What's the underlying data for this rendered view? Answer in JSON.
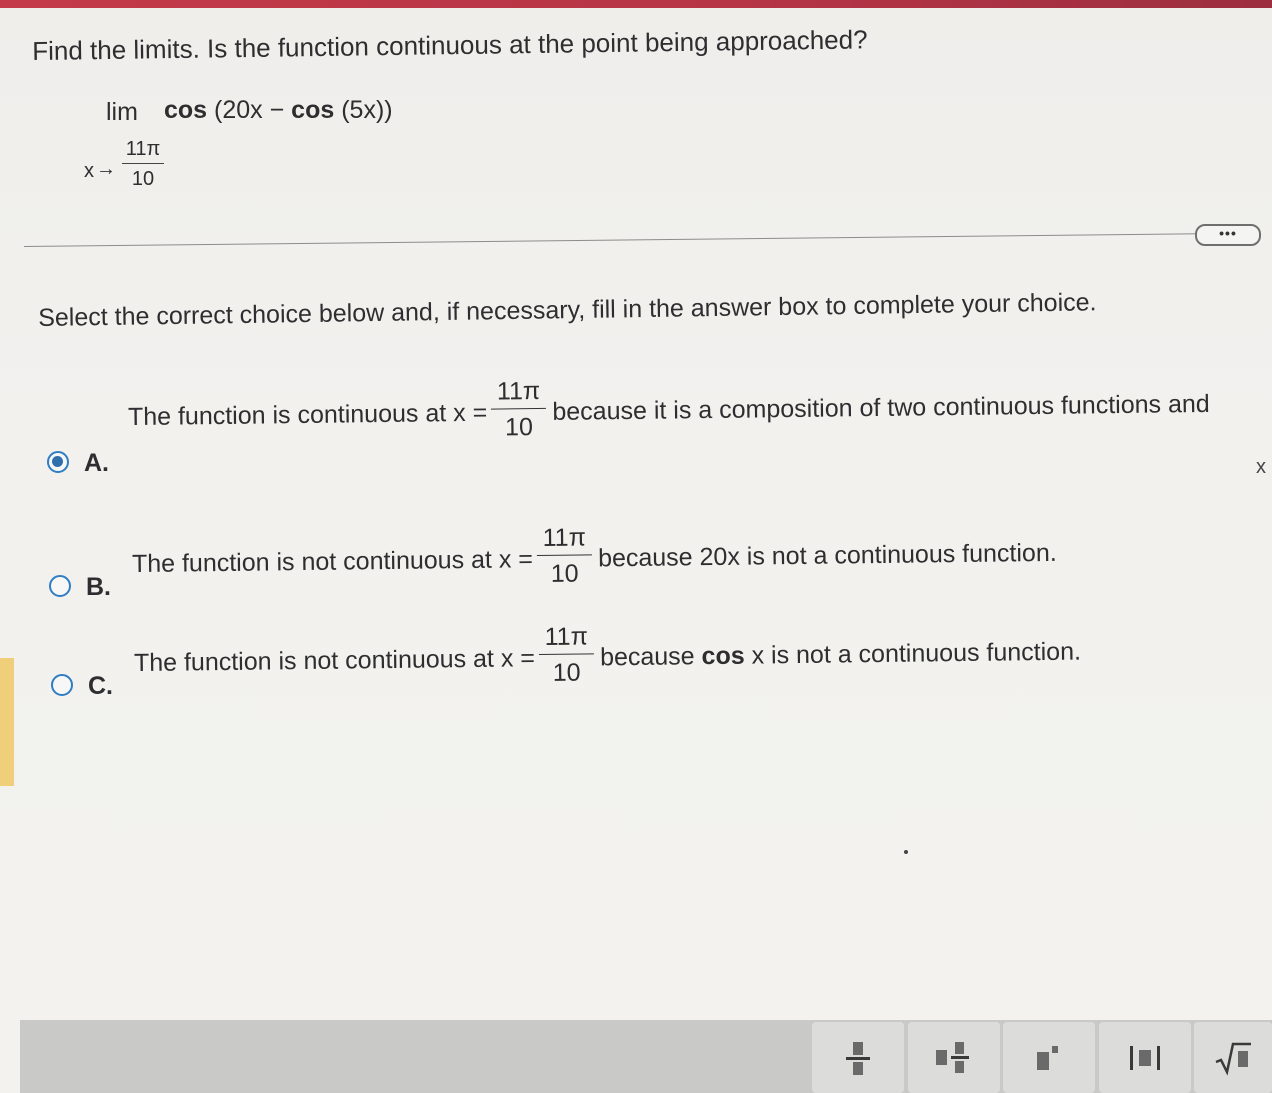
{
  "question": {
    "text": "Find the limits. Is the function continuous at the point being approached?"
  },
  "limit": {
    "lim": "lim",
    "func_cos1": "cos",
    "func_mid": " (20x − ",
    "func_cos2": "cos",
    "func_end": " (5x))",
    "approach_var": "x",
    "arrow": "→",
    "point_num": "11π",
    "point_den": "10"
  },
  "more_button": {
    "label": "•••"
  },
  "instruction": "Select the correct choice below and, if necessary, fill in the answer box to complete your choice.",
  "choices": [
    {
      "letter": "A.",
      "selected": true,
      "prefix": "The function is continuous at x =",
      "num": "11π",
      "den": "10",
      "suffix": "because it is a composition of two continuous functions and"
    },
    {
      "letter": "B.",
      "selected": false,
      "prefix": "The function is not continuous at x =",
      "num": "11π",
      "den": "10",
      "suffix": "because 20x is not a continuous function."
    },
    {
      "letter": "C.",
      "selected": false,
      "prefix": "The function is not continuous at x =",
      "num": "11π",
      "den": "10",
      "suffix_a": "because ",
      "suffix_bold": "cos",
      "suffix_b": " x is not a continuous function."
    }
  ],
  "close_icon": "x",
  "toolbar": {
    "tools": [
      "fraction-icon",
      "mixed-number-icon",
      "exponent-icon",
      "absolute-value-icon",
      "square-root-icon"
    ]
  },
  "colors": {
    "accent_top": "#c43a4a",
    "radio_blue": "#2f7ec4",
    "left_tab": "#f0cf7a",
    "toolbar": "#c9c9c7"
  }
}
